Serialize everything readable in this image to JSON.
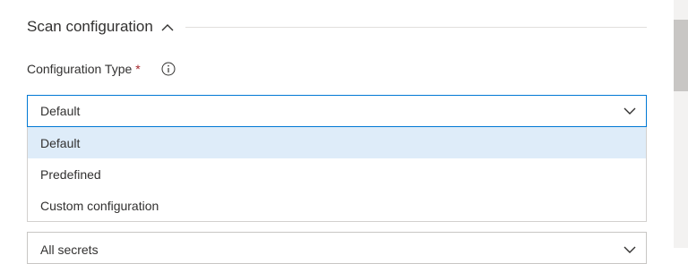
{
  "section": {
    "title": "Scan configuration",
    "collapse_icon": "chevron-up-icon"
  },
  "field": {
    "label": "Configuration Type",
    "required_mark": "*",
    "info_icon": "info-icon"
  },
  "dropdown": {
    "selected_value": "Default",
    "expanded": true,
    "chevron_icon": "chevron-down-icon",
    "options": [
      {
        "label": "Default",
        "selected": true
      },
      {
        "label": "Predefined",
        "selected": false
      },
      {
        "label": "Custom configuration",
        "selected": false
      }
    ]
  },
  "next_dropdown": {
    "value": "All secrets",
    "chevron_icon": "chevron-down-icon"
  },
  "colors": {
    "accent": "#0078d4",
    "required": "#a4262c",
    "selected_option_bg": "#deecf9",
    "text": "#323130"
  }
}
